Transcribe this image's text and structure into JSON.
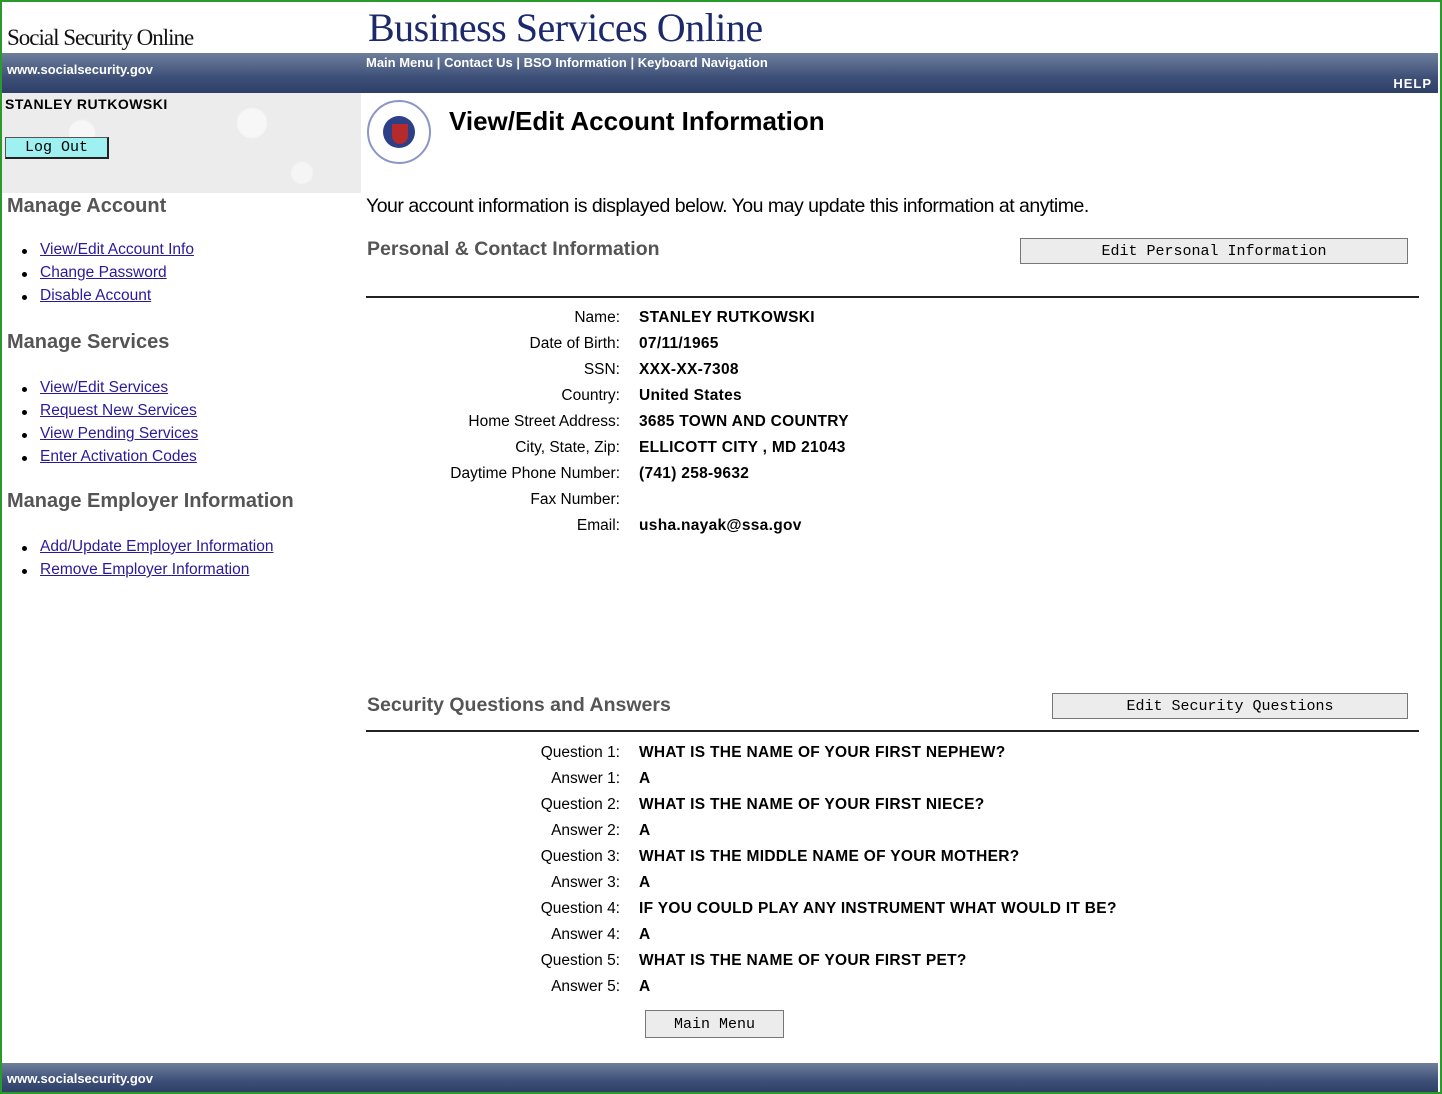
{
  "header": {
    "brand_left": "Social Security Online",
    "brand_title": "Business Services Online",
    "site_url": "www.socialsecurity.gov",
    "nav": [
      "Main Menu",
      "Contact Us",
      "BSO Information",
      "Keyboard Navigation"
    ],
    "nav_separator": "|",
    "help": "HELP"
  },
  "user": {
    "name": "STANLEY RUTKOWSKI",
    "logout_label": "Log Out"
  },
  "sidebar": {
    "manage_account": {
      "heading": "Manage Account",
      "items": [
        "View/Edit Account Info",
        "Change Password",
        "Disable Account"
      ]
    },
    "manage_services": {
      "heading": "Manage Services",
      "items": [
        "View/Edit Services",
        "Request New Services",
        "View Pending Services",
        "Enter Activation Codes"
      ]
    },
    "manage_employer": {
      "heading": "Manage Employer Information",
      "items": [
        "Add/Update Employer Information",
        "Remove Employer Information"
      ]
    }
  },
  "main": {
    "title": "View/Edit Account Information",
    "intro": "Your account information is displayed below. You may update this information at anytime.",
    "personal": {
      "heading": "Personal & Contact Information",
      "edit_label": "Edit Personal Information",
      "rows": [
        {
          "label": "Name:",
          "value": "STANLEY RUTKOWSKI"
        },
        {
          "label": "Date of Birth:",
          "value": "07/11/1965"
        },
        {
          "label": "SSN:",
          "value": "XXX-XX-7308"
        },
        {
          "label": "Country:",
          "value": "United States"
        },
        {
          "label": "Home Street Address:",
          "value": "3685 TOWN AND COUNTRY"
        },
        {
          "label": "City, State, Zip:",
          "value": "ELLICOTT CITY , MD 21043"
        },
        {
          "label": "Daytime Phone Number:",
          "value": "(741) 258-9632"
        },
        {
          "label": "Fax Number:",
          "value": ""
        },
        {
          "label": "Email:",
          "value": "usha.nayak@ssa.gov"
        }
      ]
    },
    "security": {
      "heading": "Security Questions and Answers",
      "edit_label": "Edit Security Questions",
      "rows": [
        {
          "label": "Question 1:",
          "value": "WHAT IS THE NAME OF YOUR FIRST NEPHEW?"
        },
        {
          "label": "Answer 1:",
          "value": "A"
        },
        {
          "label": "Question 2:",
          "value": "WHAT IS THE NAME OF YOUR FIRST NIECE?"
        },
        {
          "label": "Answer 2:",
          "value": "A"
        },
        {
          "label": "Question 3:",
          "value": "WHAT IS THE MIDDLE NAME OF YOUR MOTHER?"
        },
        {
          "label": "Answer 3:",
          "value": "A"
        },
        {
          "label": "Question 4:",
          "value": "IF YOU COULD PLAY ANY INSTRUMENT WHAT WOULD IT BE?"
        },
        {
          "label": "Answer 4:",
          "value": "A"
        },
        {
          "label": "Question 5:",
          "value": "WHAT IS THE NAME OF YOUR FIRST PET?"
        },
        {
          "label": "Answer 5:",
          "value": "A"
        }
      ]
    },
    "main_menu_label": "Main Menu"
  },
  "footer": {
    "site_url": "www.socialsecurity.gov"
  },
  "colors": {
    "header_bar": "#3e5078",
    "link": "#2a1a9a",
    "logout_button": "#9ff0f0",
    "frame_border": "#2a9a2a"
  }
}
